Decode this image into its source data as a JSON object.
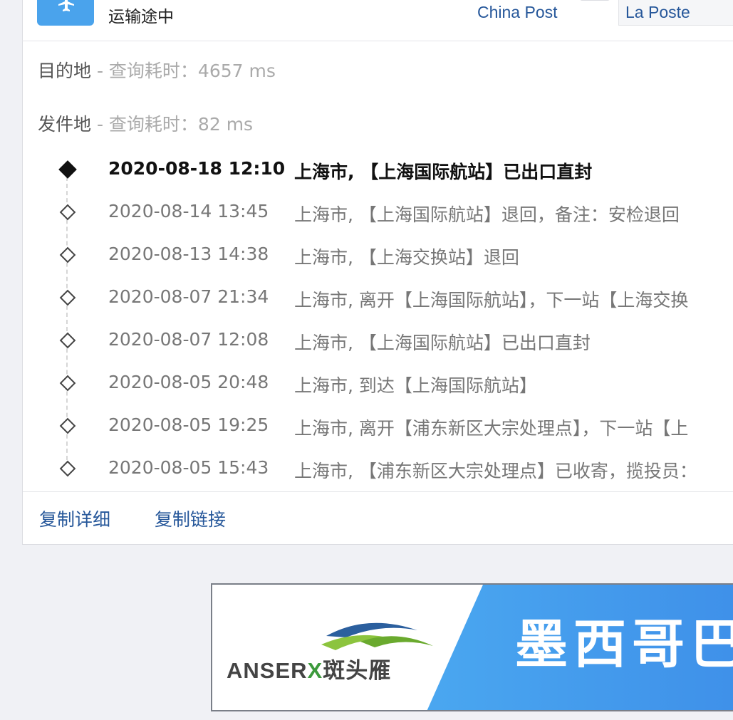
{
  "status": {
    "icon": "airplane-icon",
    "text": "运输途中"
  },
  "carriers": {
    "from": "China Post",
    "to": "La Poste"
  },
  "queries": [
    {
      "label": "目的地",
      "meta": " - 查询耗时：4657 ms"
    },
    {
      "label": "发件地",
      "meta": " - 查询耗时：82 ms"
    }
  ],
  "events": [
    {
      "time": "2020-08-18 12:10",
      "desc": "上海市, 【上海国际航站】已出口直封"
    },
    {
      "time": "2020-08-14 13:45",
      "desc": "上海市, 【上海国际航站】退回，备注：安检退回"
    },
    {
      "time": "2020-08-13 14:38",
      "desc": "上海市, 【上海交换站】退回"
    },
    {
      "time": "2020-08-07 21:34",
      "desc": "上海市, 离开【上海国际航站】，下一站【上海交换"
    },
    {
      "time": "2020-08-07 12:08",
      "desc": "上海市, 【上海国际航站】已出口直封"
    },
    {
      "time": "2020-08-05 20:48",
      "desc": "上海市, 到达【上海国际航站】"
    },
    {
      "time": "2020-08-05 19:25",
      "desc": "上海市, 离开【浦东新区大宗处理点】，下一站【上"
    },
    {
      "time": "2020-08-05 15:43",
      "desc": "上海市, 【浦东新区大宗处理点】已收寄，揽投员："
    }
  ],
  "actions": {
    "copy_detail": "复制详细",
    "copy_link": "复制链接"
  },
  "banner": {
    "brand": "ANSER",
    "brand_x": "X",
    "brand_cn": "斑头雁",
    "headline": "墨西哥巴"
  },
  "colors": {
    "accent_link": "#26579a",
    "status_icon_bg": "#4aa3ec",
    "banner_blue": "#4aa7f0"
  }
}
